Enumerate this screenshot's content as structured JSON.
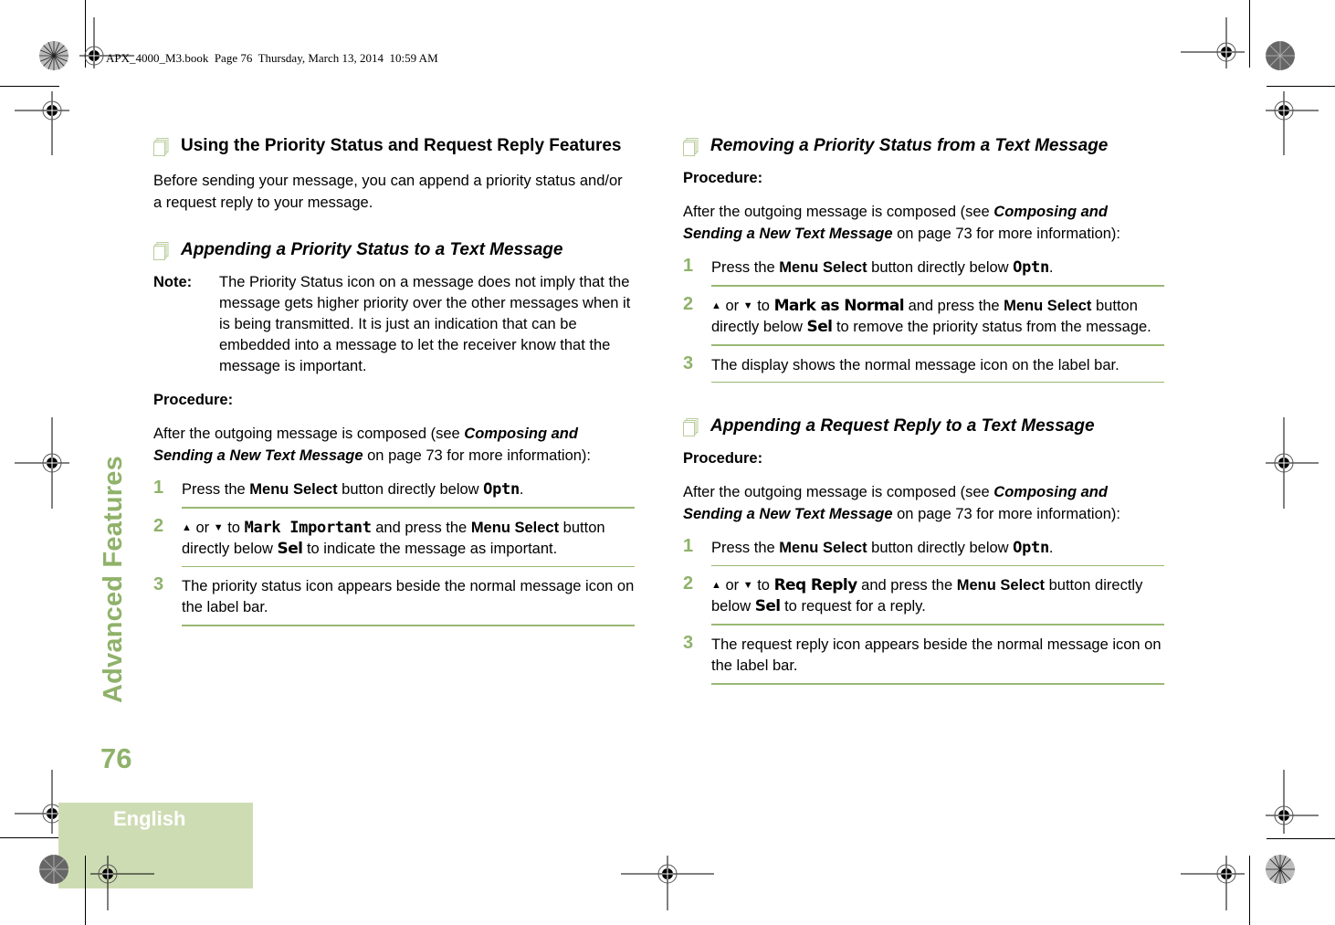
{
  "book_header": "APX_4000_M3.book  Page 76  Thursday, March 13, 2014  10:59 AM",
  "side_title": "Advanced Features",
  "page_number": "76",
  "language_tab": "English",
  "colors": {
    "accent_green": "#8fb26a",
    "tab_bg": "#cedcb4",
    "rule_green": "#99b874"
  },
  "left": {
    "main_heading": "Using the Priority Status and Request Reply Features",
    "intro": "Before sending your message, you can append a priority status and/or a request reply to your message.",
    "section1": {
      "heading": "Appending a Priority Status to a Text Message",
      "note_label": "Note:",
      "note_text": "The Priority Status icon on a message does not imply that the message gets higher priority over the other messages when it is being transmitted. It is just an indication that can be embedded into a message to let the receiver know that the message is important.",
      "procedure_label": "Procedure:",
      "pre_text": "After the outgoing message is composed (see ",
      "link_text": "Composing and Sending a New Text Message",
      "post_text": " on page 73 for more information):",
      "steps": [
        {
          "num": "1",
          "a": "Press the ",
          "b": "Menu Select",
          "c": " button directly below ",
          "d": "Optn",
          "e": "."
        },
        {
          "num": "2",
          "up": "▲",
          "or": " or ",
          "down": "▼",
          "to": " to ",
          "item": "Mark Important",
          "a": " and press the ",
          "b": "Menu Select",
          "c": " button directly below ",
          "d": "Sel",
          "e": " to indicate the message as important."
        },
        {
          "num": "3",
          "text": "The priority status icon appears beside the normal message icon on the label bar."
        }
      ]
    }
  },
  "right": {
    "section2": {
      "heading": "Removing a Priority Status from a Text Message",
      "procedure_label": "Procedure:",
      "pre_text": "After the outgoing message is composed (see ",
      "link_text": "Composing and Sending a New Text Message",
      "post_text": " on page 73 for more information):",
      "steps": [
        {
          "num": "1",
          "a": "Press the ",
          "b": "Menu Select",
          "c": " button directly below ",
          "d": "Optn",
          "e": "."
        },
        {
          "num": "2",
          "up": "▲",
          "or": " or ",
          "down": "▼",
          "to": " to ",
          "item": "Mark as Normal",
          "a": " and press the ",
          "b": "Menu Select",
          "c": " button directly below ",
          "d": "Sel",
          "e": " to remove the priority status from the message."
        },
        {
          "num": "3",
          "text": "The display shows the normal message icon on the label bar."
        }
      ]
    },
    "section3": {
      "heading": "Appending a Request Reply to a Text Message",
      "procedure_label": "Procedure:",
      "pre_text": "After the outgoing message is composed (see ",
      "link_text": "Composing and Sending a New Text Message",
      "post_text": " on page 73 for more information):",
      "steps": [
        {
          "num": "1",
          "a": "Press the ",
          "b": "Menu Select",
          "c": " button directly below ",
          "d": "Optn",
          "e": "."
        },
        {
          "num": "2",
          "up": "▲",
          "or": " or ",
          "down": "▼",
          "to": " to ",
          "item": "Req Reply",
          "a": " and press the ",
          "b": "Menu Select",
          "c": " button directly below ",
          "d": "Sel",
          "e": " to request for a reply."
        },
        {
          "num": "3",
          "text": "The request reply icon appears beside the normal message icon on the label bar."
        }
      ]
    }
  }
}
